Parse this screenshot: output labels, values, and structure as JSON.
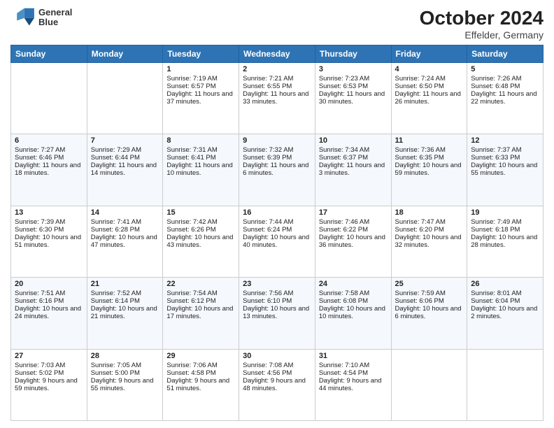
{
  "header": {
    "logo_line1": "General",
    "logo_line2": "Blue",
    "month_title": "October 2024",
    "location": "Effelder, Germany"
  },
  "days_of_week": [
    "Sunday",
    "Monday",
    "Tuesday",
    "Wednesday",
    "Thursday",
    "Friday",
    "Saturday"
  ],
  "weeks": [
    [
      {
        "day": "",
        "sunrise": "",
        "sunset": "",
        "daylight": "",
        "empty": true
      },
      {
        "day": "",
        "sunrise": "",
        "sunset": "",
        "daylight": "",
        "empty": true
      },
      {
        "day": "1",
        "sunrise": "Sunrise: 7:19 AM",
        "sunset": "Sunset: 6:57 PM",
        "daylight": "Daylight: 11 hours and 37 minutes."
      },
      {
        "day": "2",
        "sunrise": "Sunrise: 7:21 AM",
        "sunset": "Sunset: 6:55 PM",
        "daylight": "Daylight: 11 hours and 33 minutes."
      },
      {
        "day": "3",
        "sunrise": "Sunrise: 7:23 AM",
        "sunset": "Sunset: 6:53 PM",
        "daylight": "Daylight: 11 hours and 30 minutes."
      },
      {
        "day": "4",
        "sunrise": "Sunrise: 7:24 AM",
        "sunset": "Sunset: 6:50 PM",
        "daylight": "Daylight: 11 hours and 26 minutes."
      },
      {
        "day": "5",
        "sunrise": "Sunrise: 7:26 AM",
        "sunset": "Sunset: 6:48 PM",
        "daylight": "Daylight: 11 hours and 22 minutes."
      }
    ],
    [
      {
        "day": "6",
        "sunrise": "Sunrise: 7:27 AM",
        "sunset": "Sunset: 6:46 PM",
        "daylight": "Daylight: 11 hours and 18 minutes."
      },
      {
        "day": "7",
        "sunrise": "Sunrise: 7:29 AM",
        "sunset": "Sunset: 6:44 PM",
        "daylight": "Daylight: 11 hours and 14 minutes."
      },
      {
        "day": "8",
        "sunrise": "Sunrise: 7:31 AM",
        "sunset": "Sunset: 6:41 PM",
        "daylight": "Daylight: 11 hours and 10 minutes."
      },
      {
        "day": "9",
        "sunrise": "Sunrise: 7:32 AM",
        "sunset": "Sunset: 6:39 PM",
        "daylight": "Daylight: 11 hours and 6 minutes."
      },
      {
        "day": "10",
        "sunrise": "Sunrise: 7:34 AM",
        "sunset": "Sunset: 6:37 PM",
        "daylight": "Daylight: 11 hours and 3 minutes."
      },
      {
        "day": "11",
        "sunrise": "Sunrise: 7:36 AM",
        "sunset": "Sunset: 6:35 PM",
        "daylight": "Daylight: 10 hours and 59 minutes."
      },
      {
        "day": "12",
        "sunrise": "Sunrise: 7:37 AM",
        "sunset": "Sunset: 6:33 PM",
        "daylight": "Daylight: 10 hours and 55 minutes."
      }
    ],
    [
      {
        "day": "13",
        "sunrise": "Sunrise: 7:39 AM",
        "sunset": "Sunset: 6:30 PM",
        "daylight": "Daylight: 10 hours and 51 minutes."
      },
      {
        "day": "14",
        "sunrise": "Sunrise: 7:41 AM",
        "sunset": "Sunset: 6:28 PM",
        "daylight": "Daylight: 10 hours and 47 minutes."
      },
      {
        "day": "15",
        "sunrise": "Sunrise: 7:42 AM",
        "sunset": "Sunset: 6:26 PM",
        "daylight": "Daylight: 10 hours and 43 minutes."
      },
      {
        "day": "16",
        "sunrise": "Sunrise: 7:44 AM",
        "sunset": "Sunset: 6:24 PM",
        "daylight": "Daylight: 10 hours and 40 minutes."
      },
      {
        "day": "17",
        "sunrise": "Sunrise: 7:46 AM",
        "sunset": "Sunset: 6:22 PM",
        "daylight": "Daylight: 10 hours and 36 minutes."
      },
      {
        "day": "18",
        "sunrise": "Sunrise: 7:47 AM",
        "sunset": "Sunset: 6:20 PM",
        "daylight": "Daylight: 10 hours and 32 minutes."
      },
      {
        "day": "19",
        "sunrise": "Sunrise: 7:49 AM",
        "sunset": "Sunset: 6:18 PM",
        "daylight": "Daylight: 10 hours and 28 minutes."
      }
    ],
    [
      {
        "day": "20",
        "sunrise": "Sunrise: 7:51 AM",
        "sunset": "Sunset: 6:16 PM",
        "daylight": "Daylight: 10 hours and 24 minutes."
      },
      {
        "day": "21",
        "sunrise": "Sunrise: 7:52 AM",
        "sunset": "Sunset: 6:14 PM",
        "daylight": "Daylight: 10 hours and 21 minutes."
      },
      {
        "day": "22",
        "sunrise": "Sunrise: 7:54 AM",
        "sunset": "Sunset: 6:12 PM",
        "daylight": "Daylight: 10 hours and 17 minutes."
      },
      {
        "day": "23",
        "sunrise": "Sunrise: 7:56 AM",
        "sunset": "Sunset: 6:10 PM",
        "daylight": "Daylight: 10 hours and 13 minutes."
      },
      {
        "day": "24",
        "sunrise": "Sunrise: 7:58 AM",
        "sunset": "Sunset: 6:08 PM",
        "daylight": "Daylight: 10 hours and 10 minutes."
      },
      {
        "day": "25",
        "sunrise": "Sunrise: 7:59 AM",
        "sunset": "Sunset: 6:06 PM",
        "daylight": "Daylight: 10 hours and 6 minutes."
      },
      {
        "day": "26",
        "sunrise": "Sunrise: 8:01 AM",
        "sunset": "Sunset: 6:04 PM",
        "daylight": "Daylight: 10 hours and 2 minutes."
      }
    ],
    [
      {
        "day": "27",
        "sunrise": "Sunrise: 7:03 AM",
        "sunset": "Sunset: 5:02 PM",
        "daylight": "Daylight: 9 hours and 59 minutes."
      },
      {
        "day": "28",
        "sunrise": "Sunrise: 7:05 AM",
        "sunset": "Sunset: 5:00 PM",
        "daylight": "Daylight: 9 hours and 55 minutes."
      },
      {
        "day": "29",
        "sunrise": "Sunrise: 7:06 AM",
        "sunset": "Sunset: 4:58 PM",
        "daylight": "Daylight: 9 hours and 51 minutes."
      },
      {
        "day": "30",
        "sunrise": "Sunrise: 7:08 AM",
        "sunset": "Sunset: 4:56 PM",
        "daylight": "Daylight: 9 hours and 48 minutes."
      },
      {
        "day": "31",
        "sunrise": "Sunrise: 7:10 AM",
        "sunset": "Sunset: 4:54 PM",
        "daylight": "Daylight: 9 hours and 44 minutes."
      },
      {
        "day": "",
        "sunrise": "",
        "sunset": "",
        "daylight": "",
        "empty": true
      },
      {
        "day": "",
        "sunrise": "",
        "sunset": "",
        "daylight": "",
        "empty": true
      }
    ]
  ]
}
